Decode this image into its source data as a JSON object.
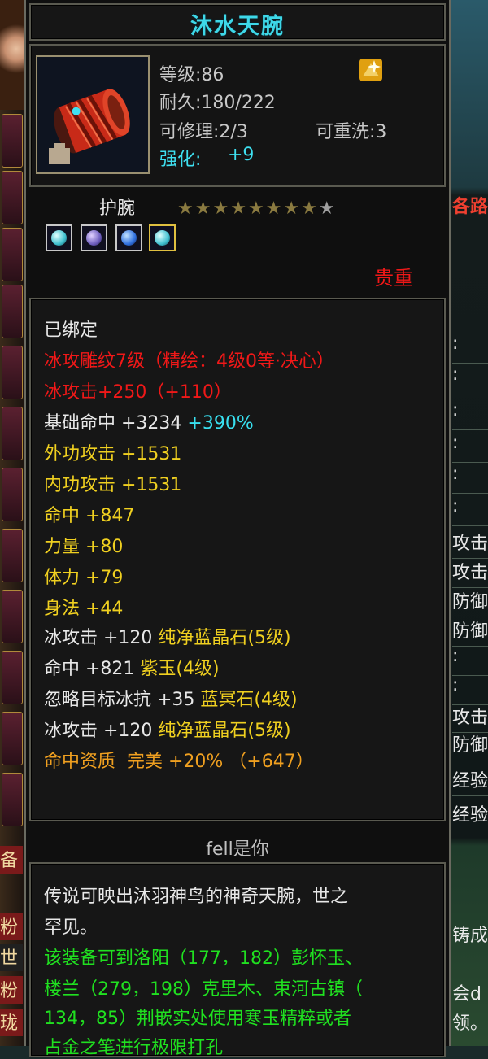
{
  "item": {
    "name": "沐水天腕",
    "level": "等级:86",
    "durability": "耐久:180/222",
    "repairable": "可修理:2/3",
    "rewashable": "可重洗:3",
    "enhance_label": "强化:",
    "enhance_value": "+9",
    "type": "护腕",
    "stars": {
      "total": 9,
      "lit": 8
    },
    "rarity": "贵重",
    "gems": [
      {
        "color": "#40c0d0",
        "selected": false
      },
      {
        "color": "#7060c0",
        "selected": false
      },
      {
        "color": "#3070e0",
        "selected": false
      },
      {
        "color": "#40c0d0",
        "selected": true
      }
    ]
  },
  "attributes": {
    "bound": "已绑定",
    "engrave": "冰攻雕纹7级（精绘：4级0等·决心）",
    "ice_attack": "冰攻击+250（+110）",
    "base_hit_label": "基础命中 +3234",
    "base_hit_pct": "+390%",
    "outer_attack": "外功攻击 +1531",
    "inner_attack": "内功攻击 +1531",
    "hit": "命中 +847",
    "strength": "力量 +80",
    "stamina": "体力 +79",
    "agility": "身法 +44",
    "gem1_stat": "冰攻击 +120",
    "gem1_name": "纯净蓝晶石(5级)",
    "gem2_stat": "命中 +821",
    "gem2_name": "紫玉(4级)",
    "gem3_stat": "忽略目标冰抗 +35",
    "gem3_name": "蓝冥石(4级)",
    "gem4_stat": "冰攻击 +120",
    "gem4_name": "纯净蓝晶石(5级)",
    "quality": "命中资质  完美 +20% （+647）"
  },
  "owner": "fell是你",
  "description": {
    "line1": "传说可映出沐羽神鸟的神奇天腕，世之",
    "line2": "罕见。",
    "line3": "该装备可到洛阳（177，182）彭怀玉、",
    "line4": "楼兰（279，198）克里木、束河古镇（",
    "line5": "134，85）荆嵌实处使用寒玉精粹或者",
    "line6": "占金之笔进行极限打孔"
  },
  "right_panel": {
    "tab": "各路",
    "rows": [
      ":",
      ":",
      ":",
      ":",
      ":",
      ":",
      "攻击",
      "攻击",
      "防御",
      "防御",
      ":",
      ":",
      "攻击",
      "防御",
      "经验",
      "经验"
    ],
    "bottom": [
      "铸成",
      "会d",
      "领。"
    ]
  },
  "left_panel": {
    "tags": [
      "备",
      "粉",
      "世",
      "粉",
      "珑"
    ]
  }
}
